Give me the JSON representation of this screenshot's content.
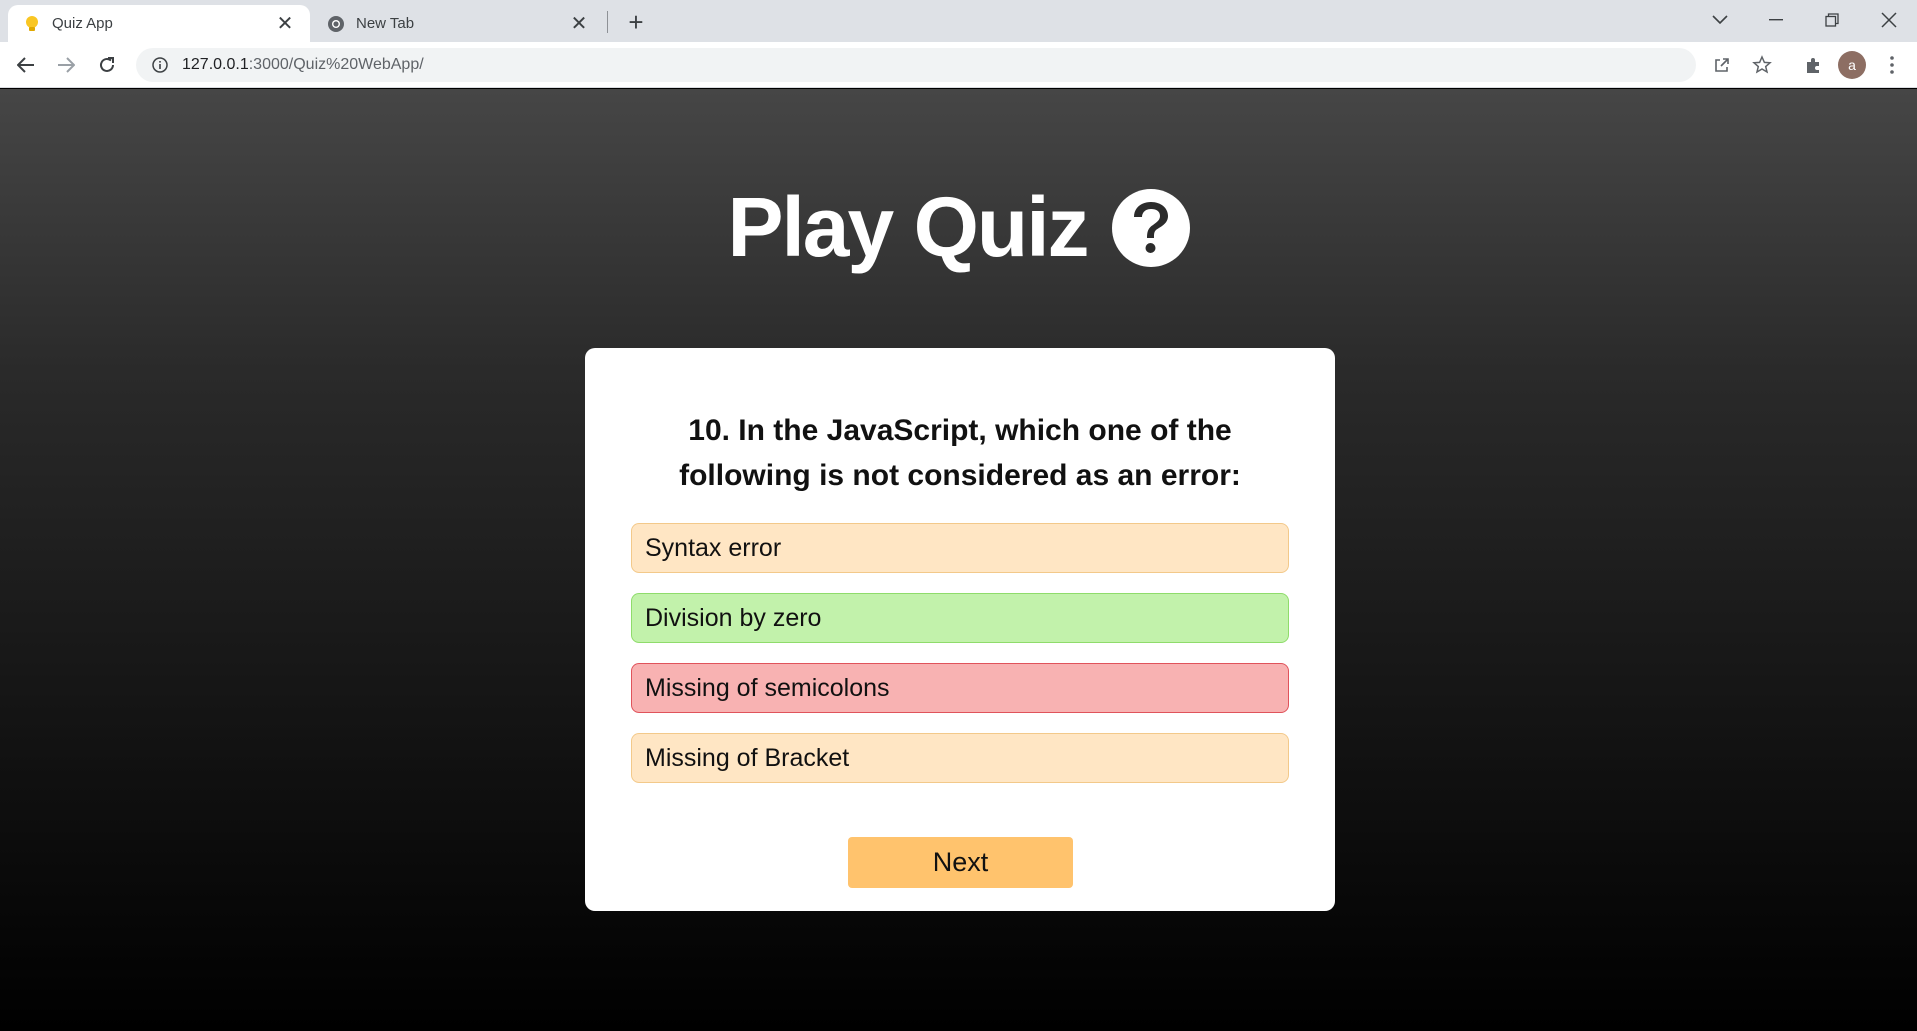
{
  "browser": {
    "tabs": [
      {
        "title": "Quiz App",
        "active": true,
        "favicon": "lightbulb-icon"
      },
      {
        "title": "New Tab",
        "active": false,
        "favicon": "chrome-icon"
      }
    ],
    "url_host": "127.0.0.1",
    "url_rest": ":3000/Quiz%20WebApp/",
    "profile_initial": "a"
  },
  "page": {
    "title": "Play Quiz",
    "title_icon": "question-circle-icon"
  },
  "quiz": {
    "question_line1": "10. In the JavaScript, which one of the",
    "question_line2": "following is not considered as an error:",
    "options": [
      {
        "label": "Syntax error",
        "state": "neutral"
      },
      {
        "label": "Division by zero",
        "state": "correct"
      },
      {
        "label": "Missing of semicolons",
        "state": "wrong"
      },
      {
        "label": "Missing of Bracket",
        "state": "neutral"
      }
    ],
    "next_label": "Next"
  },
  "colors": {
    "option_neutral": "#ffe6c4",
    "option_correct": "#c2f2ab",
    "option_wrong": "#f8b2b2",
    "next_button": "#ffc36d"
  }
}
